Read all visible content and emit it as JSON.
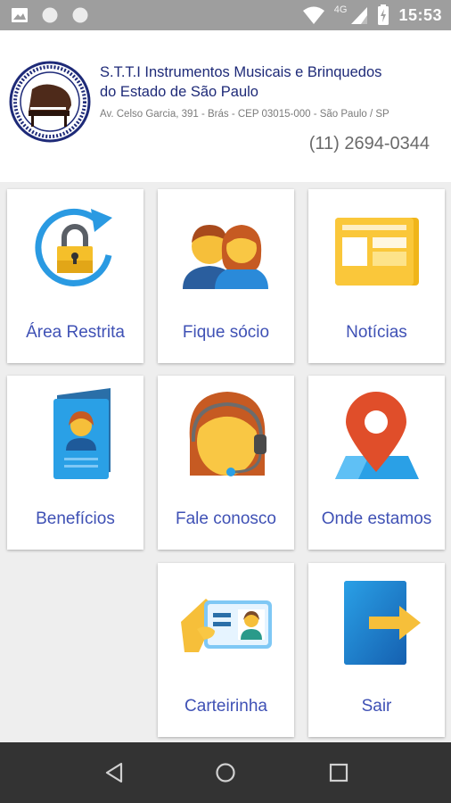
{
  "status_bar": {
    "time": "15:53",
    "network": "4G",
    "icons": [
      "image-icon",
      "circle-icon",
      "circle-icon",
      "wifi-icon",
      "signal-icon",
      "battery-charging-icon"
    ]
  },
  "header": {
    "org_name_line1": "S.T.T.I Instrumentos Musicais e Brinquedos",
    "org_name_line2": "do Estado de São Paulo",
    "address": "Av. Celso Garcia, 391 - Brás -  CEP 03015-000 - São Paulo / SP",
    "phone": "(11) 2694-0344",
    "logo_icon": "piano-seal-logo"
  },
  "menu": {
    "items": [
      {
        "label": "Área Restrita",
        "icon": "lock-refresh-icon"
      },
      {
        "label": "Fique sócio",
        "icon": "people-icon"
      },
      {
        "label": "Notícias",
        "icon": "newspaper-icon"
      },
      {
        "label": "Benefícios",
        "icon": "id-booklet-icon"
      },
      {
        "label": "Fale conosco",
        "icon": "headset-agent-icon"
      },
      {
        "label": "Onde estamos",
        "icon": "map-pin-icon"
      },
      {
        "label": "Carteirinha",
        "icon": "id-card-icon"
      },
      {
        "label": "Sair",
        "icon": "exit-door-icon"
      }
    ]
  },
  "nav_bar": {
    "buttons": [
      "back-icon",
      "home-icon",
      "recents-icon"
    ]
  },
  "colors": {
    "status_bar": "#9e9e9e",
    "label_blue": "#3f51b5",
    "org_name": "#1e2a78",
    "nav_bar": "#333333"
  }
}
